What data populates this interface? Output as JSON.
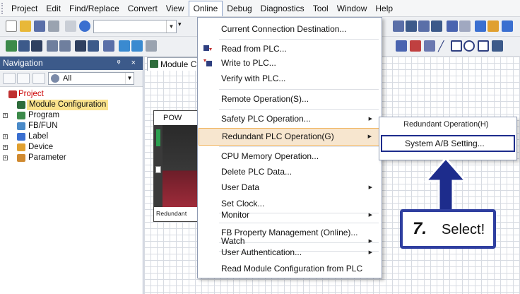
{
  "menubar": {
    "items": [
      "Project",
      "Edit",
      "Find/Replace",
      "Convert",
      "View",
      "Online",
      "Debug",
      "Diagnostics",
      "Tool",
      "Window",
      "Help"
    ],
    "active": "Online"
  },
  "navigation": {
    "title": "Navigation",
    "pin_close": "2 ×",
    "filter_value": "All",
    "tree": [
      {
        "label": "Project",
        "kind": "project"
      },
      {
        "label": "Module Configuration",
        "kind": "selected"
      },
      {
        "label": "Program",
        "kind": "expandable"
      },
      {
        "label": "FB/FUN",
        "kind": "leaf"
      },
      {
        "label": "Label",
        "kind": "expandable"
      },
      {
        "label": "Device",
        "kind": "expandable"
      },
      {
        "label": "Parameter",
        "kind": "expandable"
      }
    ]
  },
  "editor": {
    "tab_label": "Module C",
    "rack_top_label": "POW",
    "rack_caption": "Redundant"
  },
  "online_menu": {
    "items": [
      {
        "label": "Current Connection Destination...",
        "submenu": false
      },
      {
        "label": "Read from PLC...",
        "submenu": false,
        "icon": "read-plc-icon"
      },
      {
        "label": "Write to PLC...",
        "submenu": false,
        "icon": "write-plc-icon"
      },
      {
        "label": "Verify with PLC...",
        "submenu": false
      },
      {
        "label": "Remote Operation(S)...",
        "submenu": false
      },
      {
        "label": "Safety PLC Operation...",
        "submenu": true
      },
      {
        "label": "Redundant PLC Operation(G)",
        "submenu": true,
        "highlighted": true
      },
      {
        "label": "CPU Memory Operation...",
        "submenu": false
      },
      {
        "label": "Delete PLC Data...",
        "submenu": false
      },
      {
        "label": "User Data",
        "submenu": true
      },
      {
        "label": "Set Clock...",
        "submenu": false
      },
      {
        "label": "Monitor",
        "submenu": true
      },
      {
        "label": "FB Property Management (Online)...",
        "submenu": false
      },
      {
        "label": "Watch",
        "submenu": true
      },
      {
        "label": "User Authentication...",
        "submenu": true
      },
      {
        "label": "Read Module Configuration from PLC",
        "submenu": false
      }
    ]
  },
  "redundant_submenu": {
    "top_item": "Redundant Operation(H)",
    "selected_item": "System A/B Setting..."
  },
  "callout": {
    "step": "7.",
    "text": "Select!"
  },
  "colors": {
    "nav_header": "#3c5a8a",
    "highlight_fill": "#f7e6cf",
    "highlight_border": "#f0b25a",
    "callout_blue": "#2f3fa0",
    "selected_tree": "#fbe38c"
  }
}
